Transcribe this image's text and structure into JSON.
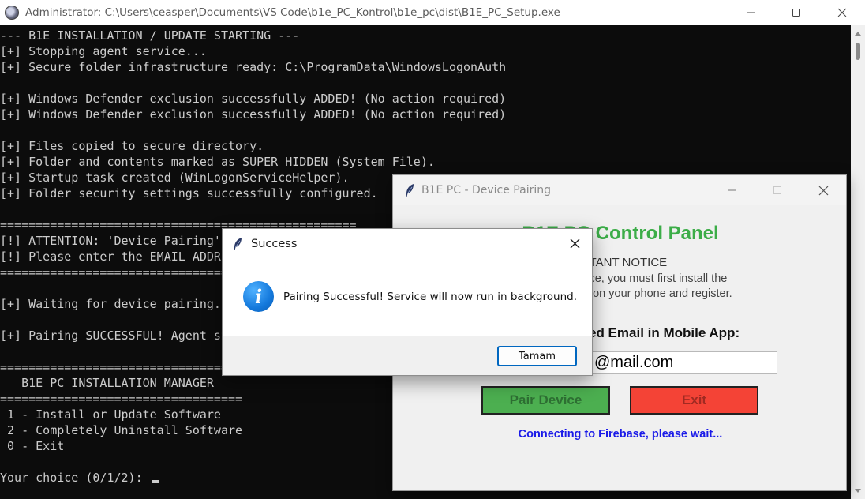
{
  "console": {
    "title": "Administrator: C:\\Users\\ceasper\\Documents\\VS Code\\b1e_PC_Kontrol\\b1e_pc\\dist\\B1E_PC_Setup.exe",
    "lines": [
      "--- B1E INSTALLATION / UPDATE STARTING ---",
      "[+] Stopping agent service...",
      "[+] Secure folder infrastructure ready: C:\\ProgramData\\WindowsLogonAuth",
      "",
      "[+] Windows Defender exclusion successfully ADDED! (No action required)",
      "[+] Windows Defender exclusion successfully ADDED! (No action required)",
      "",
      "[+] Files copied to secure directory.",
      "[+] Folder and contents marked as SUPER HIDDEN (System File).",
      "[+] Startup task created (WinLogonServiceHelper).",
      "[+] Folder security settings successfully configured.",
      "",
      "==================================================",
      "[!] ATTENTION: 'Device Pairing'",
      "[!] Please enter the EMAIL ADDRE",
      "==================================",
      "",
      "[+] Waiting for device pairing..",
      "",
      "[+] Pairing SUCCESSFUL! Agent st",
      "",
      "=================================",
      "   B1E PC INSTALLATION MANAGER",
      "==================================",
      " 1 - Install or Update Software",
      " 2 - Completely Uninstall Software",
      " 0 - Exit",
      "",
      "Your choice (0/1/2): "
    ]
  },
  "pairing_window": {
    "title": "B1E PC - Device Pairing",
    "heading": "B1E PC Control Panel",
    "notice_fragment": "RTANT NOTICE",
    "text_line1": "vice, you must first install the",
    "text_line2": "p on your phone and register.",
    "label_fragment": "ed Email in Mobile App:",
    "email_value_fragment": "@mail.com",
    "pair_button": "Pair Device",
    "exit_button": "Exit",
    "status": "Connecting to Firebase, please wait...",
    "colors": {
      "heading": "#3cad48",
      "pair_button": "#4caf50",
      "exit_button": "#f44336",
      "status": "#1b1be8"
    }
  },
  "success_dialog": {
    "title": "Success",
    "message": "Pairing Successful! Service will now run in background.",
    "ok_button": "Tamam",
    "icon": "info-icon"
  }
}
